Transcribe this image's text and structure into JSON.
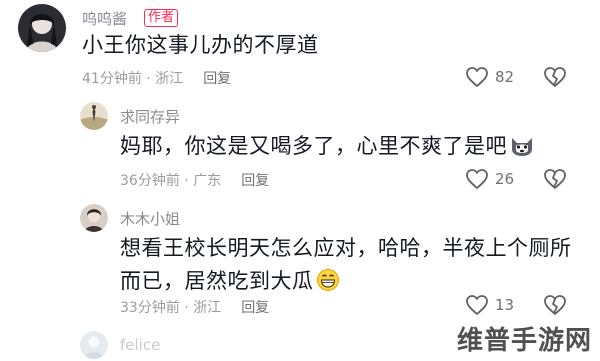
{
  "comments": [
    {
      "username": "呜呜酱",
      "badge": "作者",
      "text": "小王你这事儿办的不厚道",
      "time": "41分钟前",
      "location": "浙江",
      "reply_label": "回复",
      "likes": "82",
      "avatar_icon": "user-avatar-icon"
    },
    {
      "username": "求同存异",
      "text": "妈耶，你这是又喝多了，心里不爽了是吧",
      "time": "36分钟前",
      "location": "广东",
      "reply_label": "回复",
      "likes": "26",
      "avatar_icon": "user-avatar-icon"
    },
    {
      "username": "木木小姐",
      "text_line1": "想看王校长明天怎么应对，哈哈，半夜上个厕所",
      "text_line2": "而已，居然吃到大瓜",
      "time": "33分钟前",
      "location": "浙江",
      "reply_label": "回复",
      "likes": "13",
      "avatar_icon": "user-avatar-icon"
    },
    {
      "username": "felice",
      "avatar_icon": "user-avatar-icon"
    }
  ],
  "meta_separator": "·",
  "watermark": "维普手游网",
  "colors": {
    "badge": "#fe2c55",
    "meta_text": "#9b9ca1",
    "username": "#8a8b91"
  }
}
